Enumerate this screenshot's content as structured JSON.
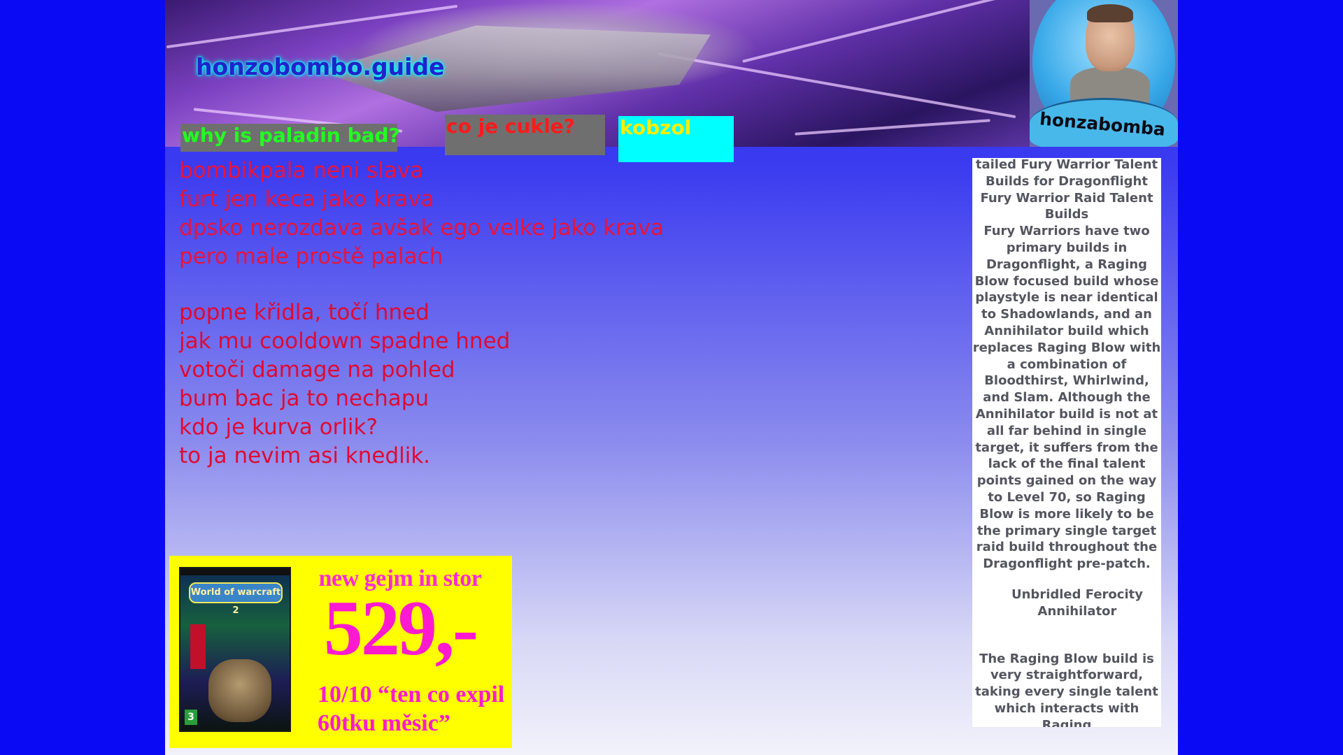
{
  "site": {
    "title": "honzobombo.guide",
    "avatar_label": "honzabomba"
  },
  "nav": [
    {
      "label": "why is paladin bad?"
    },
    {
      "label": "co je cukle?"
    },
    {
      "label": "kobzol"
    }
  ],
  "poem": {
    "stanza1": [
      "bombikpala neni slava",
      "furt jen keca jako krava",
      "dpsko nerozdava avšak ego velke jako krava",
      "pero male prostě palach"
    ],
    "stanza2": [
      "popne křidla, točí hned",
      "jak mu cooldown spadne hned",
      "votoči damage na pohled",
      "bum bac ja to nechapu",
      "kdo je kurva orlik?",
      "to ja nevim asi knedlik."
    ]
  },
  "ad": {
    "headline": "new gejm in stor",
    "price": "529,-",
    "review_line1": "10/10 “ten co expil",
    "review_line2": "60tku měsic”",
    "cover_title": "World of warcraft 2",
    "cover_rating": "3"
  },
  "article": {
    "heading": "tailed Fury Warrior Talent Builds for Dragonflight",
    "subheading": "Fury Warrior Raid Talent Builds",
    "body1": "Fury Warriors have two primary builds in Dragonflight, a Raging Blow focused build whose playstyle is near identical to Shadowlands, and an Annihilator build which replaces Raging Blow with a combination of Bloodthirst, Whirlwind, and Slam. Although the Annihilator build is not at all far behind in single target, it suffers from the lack of the final talent points gained on the way to Level 70, so Raging Blow is more likely to be the primary single target raid build throughout the Dragonflight pre-patch.",
    "builds": "Unbridled Ferocity Annihilator",
    "body2": "The Raging Blow build is very straightforward, taking every single talent which interacts with Raging"
  },
  "colors": {
    "page_bg": "#0a0af5",
    "title_glow": "#00ffff",
    "poem_text": "#e8143c",
    "ad_bg": "#ffff00",
    "ad_text": "#ff1ad0"
  }
}
